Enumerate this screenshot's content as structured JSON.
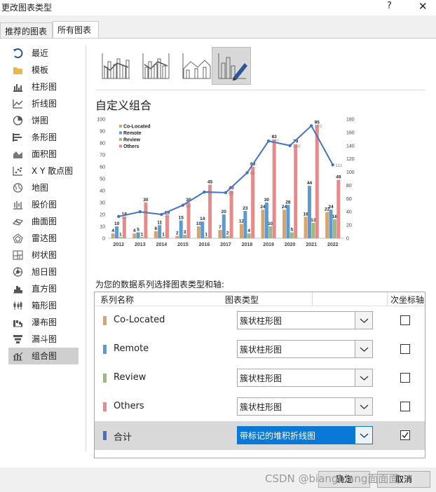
{
  "window": {
    "title": "更改图表类型",
    "help": "?",
    "close": "✕"
  },
  "tabs": [
    {
      "label": "推荐的图表"
    },
    {
      "label": "所有图表"
    }
  ],
  "sidebar": {
    "items": [
      {
        "label": "最近",
        "icon": "recent-icon"
      },
      {
        "label": "模板",
        "icon": "folder-icon"
      },
      {
        "label": "柱形图",
        "icon": "column-chart-icon"
      },
      {
        "label": "折线图",
        "icon": "line-chart-icon"
      },
      {
        "label": "饼图",
        "icon": "pie-chart-icon"
      },
      {
        "label": "条形图",
        "icon": "bar-chart-icon"
      },
      {
        "label": "面积图",
        "icon": "area-chart-icon"
      },
      {
        "label": "X Y 散点图",
        "icon": "scatter-chart-icon"
      },
      {
        "label": "地图",
        "icon": "map-chart-icon"
      },
      {
        "label": "股价图",
        "icon": "stock-chart-icon"
      },
      {
        "label": "曲面图",
        "icon": "surface-chart-icon"
      },
      {
        "label": "雷达图",
        "icon": "radar-chart-icon"
      },
      {
        "label": "树状图",
        "icon": "treemap-chart-icon"
      },
      {
        "label": "旭日图",
        "icon": "sunburst-chart-icon"
      },
      {
        "label": "直方图",
        "icon": "histogram-chart-icon"
      },
      {
        "label": "箱形图",
        "icon": "box-whisker-chart-icon"
      },
      {
        "label": "瀑布图",
        "icon": "waterfall-chart-icon"
      },
      {
        "label": "漏斗图",
        "icon": "funnel-chart-icon"
      },
      {
        "label": "组合图",
        "icon": "combo-chart-icon"
      }
    ],
    "selected_index": 18
  },
  "subtypes": [
    {
      "icon": "combo-column-line-icon"
    },
    {
      "icon": "combo-column-line-secondary-axis-icon"
    },
    {
      "icon": "combo-area-column-icon"
    },
    {
      "icon": "custom-combo-icon"
    }
  ],
  "section_title": "自定义组合",
  "series_prompt": "为您的数据系列选择图表类型和轴:",
  "table": {
    "headers": {
      "name": "系列名称",
      "type": "图表类型",
      "secondary": "次坐标轴"
    },
    "rows": [
      {
        "name": "Co-Located",
        "type": "簇状柱形图",
        "secondary": false,
        "color": "#d9a46b"
      },
      {
        "name": "Remote",
        "type": "簇状柱形图",
        "secondary": false,
        "color": "#5b9bd5"
      },
      {
        "name": "Review",
        "type": "簇状柱形图",
        "secondary": false,
        "color": "#9bbb7e"
      },
      {
        "name": "Others",
        "type": "簇状柱形图",
        "secondary": false,
        "color": "#e88a8a"
      },
      {
        "name": "合计",
        "type": "带标记的堆积折线图",
        "secondary": true,
        "color": "#4472c4"
      }
    ]
  },
  "footer": {
    "watermark": "CSDN @biangbiang面面面",
    "ok": "确定",
    "cancel": "取消"
  },
  "chart_data": {
    "type": "bar",
    "categories": [
      "2012",
      "2013",
      "2014",
      "2015",
      "2016",
      "2017",
      "2018",
      "2019",
      "2020",
      "2021",
      "2022"
    ],
    "series": [
      {
        "name": "Co-Located",
        "kind": "bar",
        "axis": "primary",
        "color": "#d9a46b",
        "values": [
          4,
          4,
          6,
          2,
          10,
          7,
          12,
          24,
          24,
          18,
          22
        ]
      },
      {
        "name": "Remote",
        "kind": "bar",
        "axis": "primary",
        "color": "#5b9bd5",
        "values": [
          10,
          5,
          11,
          15,
          14,
          20,
          23,
          30,
          28,
          44,
          24
        ]
      },
      {
        "name": "Review",
        "kind": "bar",
        "axis": "primary",
        "color": "#9bbb7e",
        "values": [
          1,
          1,
          1,
          3,
          1,
          2,
          4,
          10,
          5,
          13,
          16
        ]
      },
      {
        "name": "Others",
        "kind": "bar",
        "axis": "primary",
        "color": "#e88a8a",
        "values": [
          18,
          30,
          19,
          30,
          45,
          40,
          60,
          83,
          79,
          95,
          49
        ]
      },
      {
        "kind": "line",
        "axis": "secondary",
        "color": "#4472c4",
        "values": [
          33,
          40,
          36,
          50,
          70,
          69,
          99,
          147,
          140,
          170,
          111
        ]
      }
    ],
    "y_primary": {
      "min": 0,
      "max": 100,
      "ticks": [
        0,
        10,
        20,
        30,
        40,
        50,
        60,
        70,
        80,
        90,
        100
      ]
    },
    "y_secondary": {
      "min": 0,
      "max": 180,
      "ticks": [
        0,
        20,
        40,
        60,
        80,
        100,
        120,
        140,
        160,
        180
      ]
    },
    "legend": {
      "position": "top-left",
      "entries": [
        "Co-Located",
        "Remote",
        "Review",
        "Others"
      ]
    },
    "grid": false
  }
}
